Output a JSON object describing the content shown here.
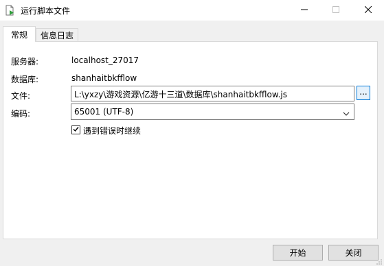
{
  "window": {
    "title": "运行脚本文件",
    "app_icon": "script-run-icon",
    "controls": [
      "minimize-icon",
      "maximize-icon",
      "close-icon"
    ]
  },
  "tabs": [
    {
      "label": "常规",
      "active": true
    },
    {
      "label": "信息日志",
      "active": false
    }
  ],
  "form": {
    "server_label": "服务器:",
    "server_value": "localhost_27017",
    "database_label": "数据库:",
    "database_value": "shanhaitbkfflow",
    "file_label": "文件:",
    "file_value": "L:\\yxzy\\游戏资源\\亿游十三道\\数据库\\shanhaitbkfflow.js",
    "browse_label": "...",
    "encoding_label": "编码:",
    "encoding_value": "65001 (UTF-8)",
    "continue_on_error_label": "遇到错误时继续",
    "continue_on_error_checked": true
  },
  "buttons": {
    "start": "开始",
    "close": "关闭"
  },
  "colors": {
    "accent": "#0078d7",
    "panel_bg": "#ffffff",
    "window_bg": "#f0f0f0"
  }
}
